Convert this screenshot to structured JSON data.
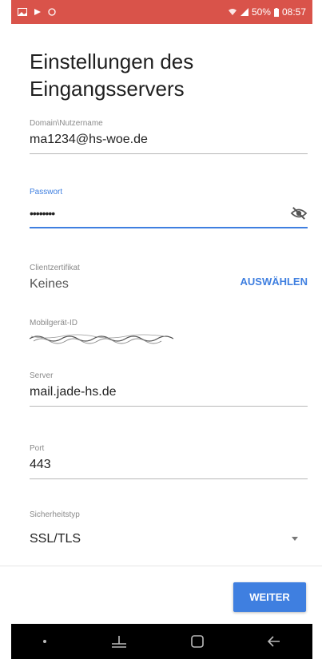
{
  "status_bar": {
    "battery": "50%",
    "time": "08:57",
    "left_icons": [
      "gallery-icon",
      "play-icon",
      "sync-icon"
    ],
    "right_icons": [
      "wifi-icon",
      "signal-icon",
      "battery-icon"
    ],
    "color": "#d9534a"
  },
  "page": {
    "title": "Einstellungen des Eingangsservers"
  },
  "fields": {
    "username": {
      "label": "Domain\\Nutzername",
      "value": "ma1234@hs-woe.de"
    },
    "password": {
      "label": "Passwort",
      "value": "••••••••"
    },
    "certificate": {
      "label": "Clientzertifikat",
      "value": "Keines",
      "action": "AUSWÄHLEN"
    },
    "device_id": {
      "label": "Mobilgerät-ID"
    },
    "server": {
      "label": "Server",
      "value": "mail.jade-hs.de"
    },
    "port": {
      "label": "Port",
      "value": "443"
    },
    "security": {
      "label": "Sicherheitstyp",
      "value": "SSL/TLS"
    }
  },
  "footer": {
    "next_label": "WEITER"
  },
  "accent_color": "#3f7fe0",
  "nav_icons": [
    "dot-icon",
    "recent-apps-icon",
    "home-icon",
    "back-icon"
  ]
}
